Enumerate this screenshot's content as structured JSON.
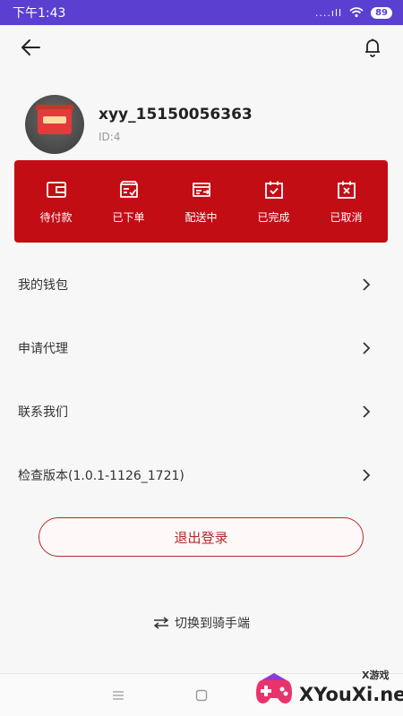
{
  "status_bar": {
    "time": "下午1:43",
    "signal": "....ıll",
    "battery": "89"
  },
  "icons": {
    "back": "back-arrow-icon",
    "bell": "bell-icon",
    "wifi": "wifi-icon",
    "chevron": "chevron-right-icon",
    "switch": "swap-arrows-icon"
  },
  "profile": {
    "username": "xyy_15150056363",
    "id_text": "ID:4"
  },
  "orders": [
    {
      "label": "待付款",
      "icon": "wallet-icon"
    },
    {
      "label": "已下单",
      "icon": "order-check-icon"
    },
    {
      "label": "配送中",
      "icon": "delivery-icon"
    },
    {
      "label": "已完成",
      "icon": "calendar-check-icon"
    },
    {
      "label": "已取消",
      "icon": "calendar-cancel-icon"
    }
  ],
  "menu": [
    {
      "label": "我的钱包"
    },
    {
      "label": "申请代理"
    },
    {
      "label": "联系我们"
    },
    {
      "label": "检查版本(1.0.1-1126_1721)"
    }
  ],
  "logout_label": "退出登录",
  "switch_label": "切换到骑手端",
  "watermark": {
    "text": "XYouXi.net",
    "cn": "X游戏"
  },
  "colors": {
    "accent": "#c30d15",
    "status_bar": "#5a3fd0",
    "logout_border": "#b32a2a"
  }
}
